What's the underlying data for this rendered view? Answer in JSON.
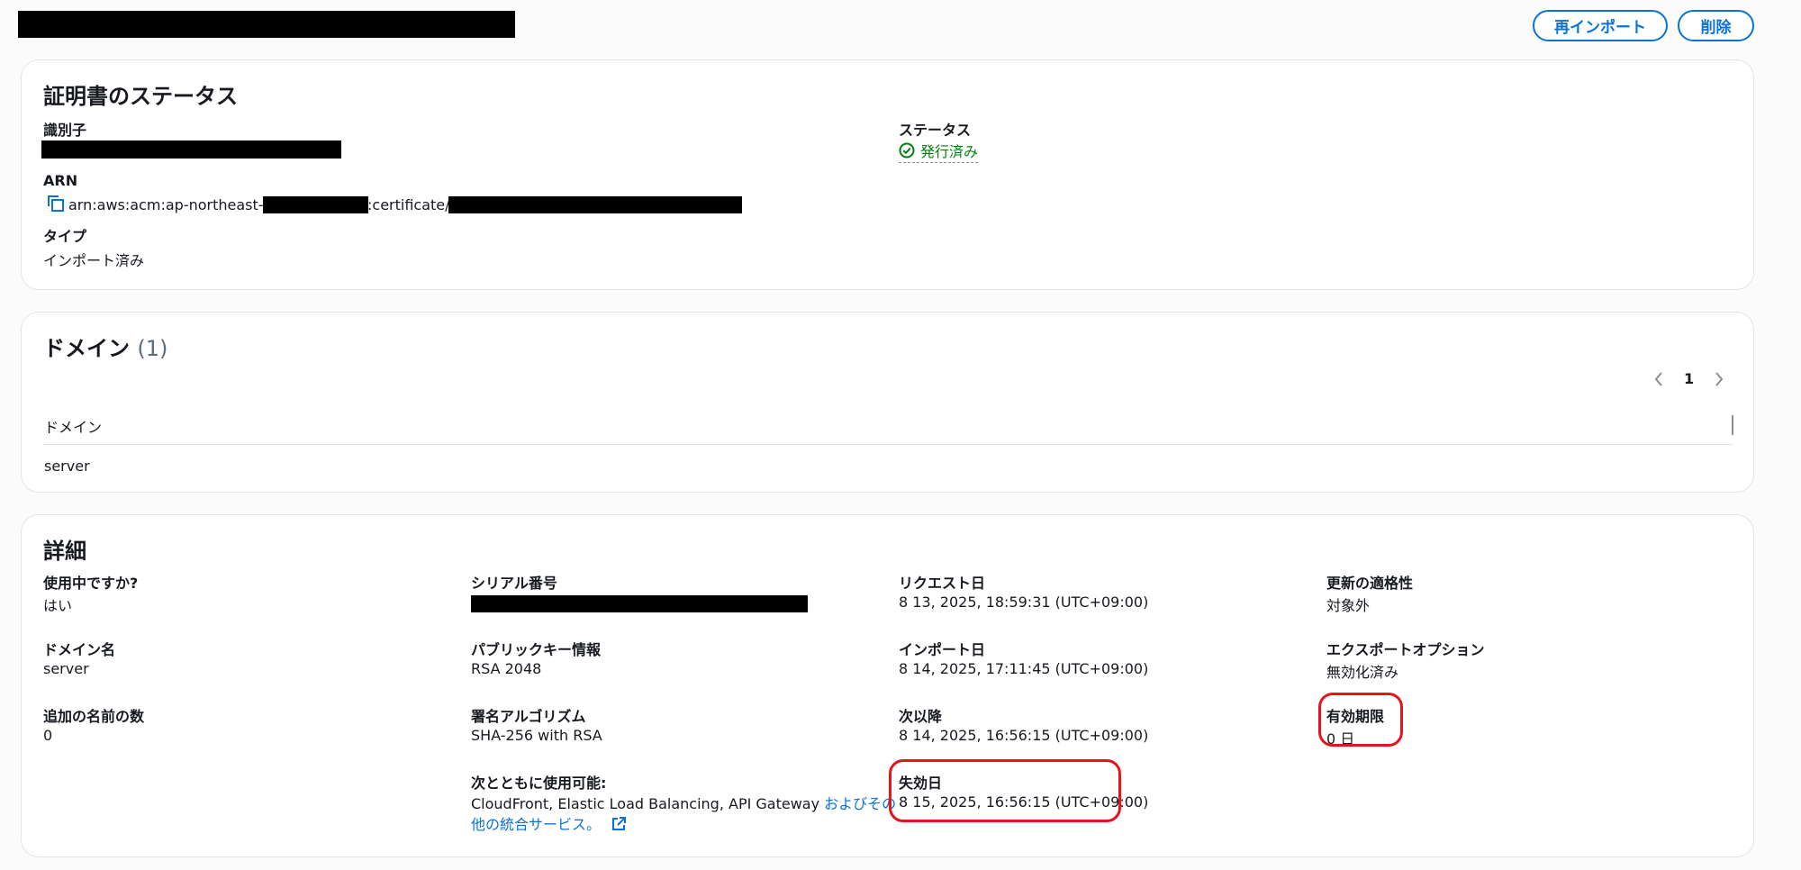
{
  "header": {
    "reimport_label": "再インポート",
    "delete_label": "削除"
  },
  "status_section": {
    "title": "証明書のステータス",
    "identifier_label": "識別子",
    "status_label": "ステータス",
    "status_value": "発行済み",
    "arn_label": "ARN",
    "arn_prefix": "arn:aws:acm:ap-northeast-1:",
    "arn_middle": ":certificate/",
    "type_label": "タイプ",
    "type_value": "インポート済み"
  },
  "domain_section": {
    "title": "ドメイン",
    "count": "(1)",
    "page": "1",
    "column_header": "ドメイン",
    "rows": [
      "server"
    ]
  },
  "details_section": {
    "title": "詳細",
    "in_use_label": "使用中ですか?",
    "in_use_value": "はい",
    "domain_name_label": "ドメイン名",
    "domain_name_value": "server",
    "additional_names_label": "追加の名前の数",
    "additional_names_value": "0",
    "serial_label": "シリアル番号",
    "public_key_label": "パブリックキー情報",
    "public_key_value": "RSA 2048",
    "signature_label": "署名アルゴリズム",
    "signature_value": "SHA-256 with RSA",
    "usable_with_label": "次とともに使用可能:",
    "usable_with_value": "CloudFront, Elastic Load Balancing, API Gateway ",
    "usable_with_link_1": "およびその",
    "usable_with_link_2": "他の統合サービス。",
    "requested_label": "リクエスト日",
    "requested_value": "8 13, 2025, 18:59:31 (UTC+09:00)",
    "imported_label": "インポート日",
    "imported_value": "8 14, 2025, 17:11:45 (UTC+09:00)",
    "not_before_label": "次以降",
    "not_before_value": "8 14, 2025, 16:56:15 (UTC+09:00)",
    "expires_label": "失効日",
    "expires_value": "8 15, 2025, 16:56:15 (UTC+09:00)",
    "renewal_label": "更新の適格性",
    "renewal_value": "対象外",
    "export_label": "エクスポートオプション",
    "export_value": "無効化済み",
    "validity_label": "有効期限",
    "validity_value": "0 日"
  },
  "colors": {
    "accent": "#0972d3",
    "success": "#037f0c",
    "highlight": "#e5141b"
  }
}
